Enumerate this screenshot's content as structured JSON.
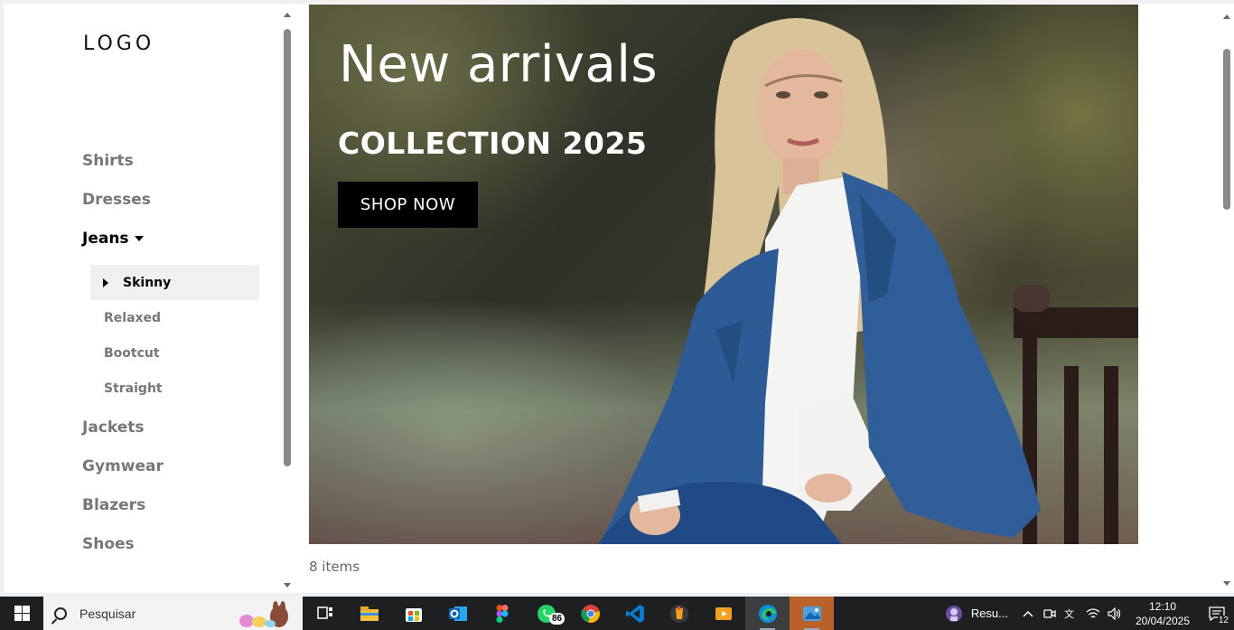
{
  "sidebar": {
    "logo": "LOGO",
    "items": [
      {
        "label": "Shirts"
      },
      {
        "label": "Dresses"
      },
      {
        "label": "Jeans",
        "expanded": true
      },
      {
        "label": "Jackets"
      },
      {
        "label": "Gymwear"
      },
      {
        "label": "Blazers"
      },
      {
        "label": "Shoes"
      }
    ],
    "jeans_sub": [
      {
        "label": "Skinny",
        "selected": true
      },
      {
        "label": "Relaxed"
      },
      {
        "label": "Bootcut"
      },
      {
        "label": "Straight"
      }
    ]
  },
  "hero": {
    "title": "New arrivals",
    "subtitle": "COLLECTION 2025",
    "button_label": "SHOP NOW"
  },
  "product_count": "8 items",
  "taskbar": {
    "search_placeholder": "Pesquisar",
    "whatsapp_badge": "86",
    "tray_app_label": "Resu...",
    "time": "12:10",
    "date": "20/04/2025",
    "notifications": "12",
    "icons": [
      "task-view-icon",
      "file-explorer-icon",
      "store-icon",
      "outlook-icon",
      "figma-icon",
      "whatsapp-icon",
      "chrome-icon",
      "vscode-icon",
      "fl-studio-icon",
      "media-player-icon",
      "edge-icon",
      "photos-icon"
    ]
  },
  "colors": {
    "nav_inactive": "#777777",
    "nav_active": "#000000",
    "subnav_selected_bg": "#f0f0f0",
    "shop_button_bg": "#000000",
    "taskbar_bg": "#1d1f20"
  }
}
